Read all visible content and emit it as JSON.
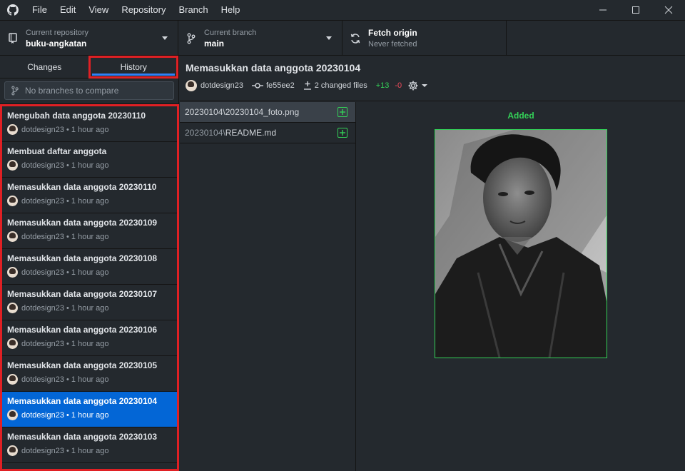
{
  "menu": [
    "File",
    "Edit",
    "View",
    "Repository",
    "Branch",
    "Help"
  ],
  "toolbar": {
    "repo_label": "Current repository",
    "repo_value": "buku-angkatan",
    "branch_label": "Current branch",
    "branch_value": "main",
    "fetch_label": "Fetch origin",
    "fetch_status": "Never fetched"
  },
  "tabs": {
    "changes": "Changes",
    "history": "History"
  },
  "compare_placeholder": "No branches to compare",
  "commits": [
    {
      "title": "Mengubah data anggota 20230110",
      "author": "dotdesign23",
      "time": "1 hour ago"
    },
    {
      "title": "Membuat daftar anggota",
      "author": "dotdesign23",
      "time": "1 hour ago"
    },
    {
      "title": "Memasukkan data anggota 20230110",
      "author": "dotdesign23",
      "time": "1 hour ago"
    },
    {
      "title": "Memasukkan data anggota 20230109",
      "author": "dotdesign23",
      "time": "1 hour ago"
    },
    {
      "title": "Memasukkan data anggota 20230108",
      "author": "dotdesign23",
      "time": "1 hour ago"
    },
    {
      "title": "Memasukkan data anggota 20230107",
      "author": "dotdesign23",
      "time": "1 hour ago"
    },
    {
      "title": "Memasukkan data anggota 20230106",
      "author": "dotdesign23",
      "time": "1 hour ago"
    },
    {
      "title": "Memasukkan data anggota 20230105",
      "author": "dotdesign23",
      "time": "1 hour ago"
    },
    {
      "title": "Memasukkan data anggota 20230104",
      "author": "dotdesign23",
      "time": "1 hour ago"
    },
    {
      "title": "Memasukkan data anggota 20230103",
      "author": "dotdesign23",
      "time": "1 hour ago"
    }
  ],
  "selected_commit": {
    "title": "Memasukkan data anggota 20230104",
    "author": "dotdesign23",
    "sha": "fe55ee2",
    "changed_files": "2 changed files",
    "additions": "+13",
    "deletions": "-0"
  },
  "files": [
    {
      "dir": "20230104\\",
      "name": "20230104_foto.png",
      "status": "added"
    },
    {
      "dir": "20230104\\",
      "name": "README.md",
      "status": "added"
    }
  ],
  "diff": {
    "status_label": "Added"
  },
  "colors": {
    "accent": "#0366d6",
    "added": "#34d058",
    "deleted": "#ea4a5a",
    "highlight": "#e02024"
  }
}
